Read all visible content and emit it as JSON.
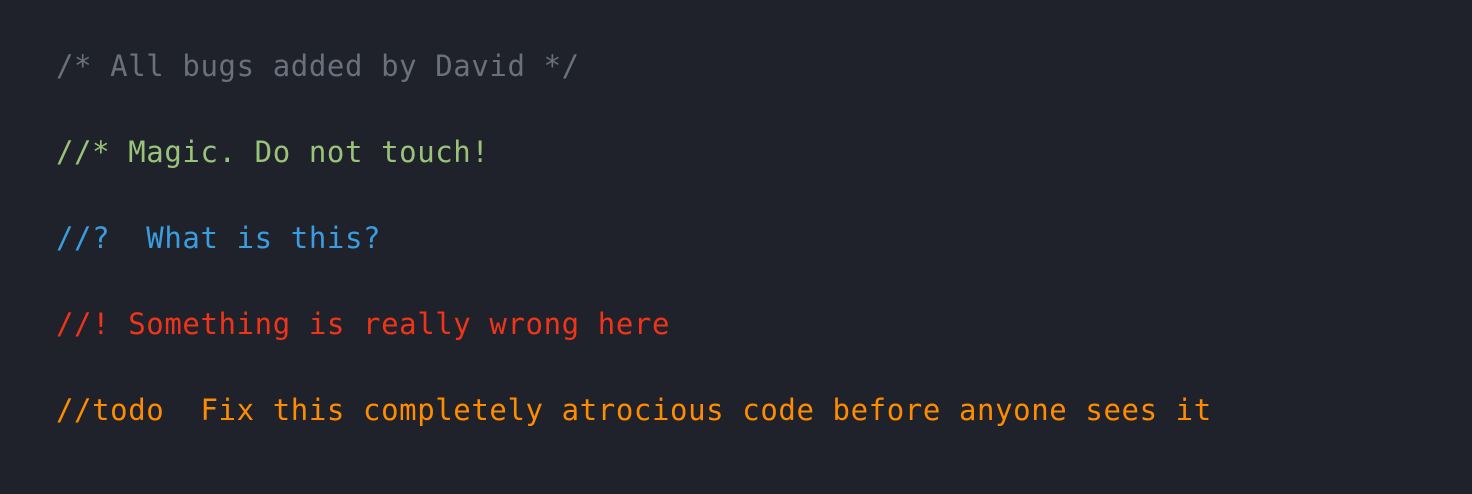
{
  "colors": {
    "background": "#1f222b",
    "comment_gray": "#6b707c",
    "comment_green": "#98c379",
    "comment_blue": "#3b9ddf",
    "comment_red": "#f0341a",
    "comment_orange": "#ff8c00"
  },
  "code": {
    "lines": [
      {
        "text": "/* All bugs added by David */",
        "color": "#6b707c"
      },
      {
        "text": "//* Magic. Do not touch!",
        "color": "#98c379"
      },
      {
        "text": "//?  What is this?",
        "color": "#3b9ddf"
      },
      {
        "text": "//! Something is really wrong here",
        "color": "#f0341a"
      },
      {
        "text": "//todo  Fix this completely atrocious code before anyone sees it",
        "color": "#ff8c00"
      }
    ]
  }
}
